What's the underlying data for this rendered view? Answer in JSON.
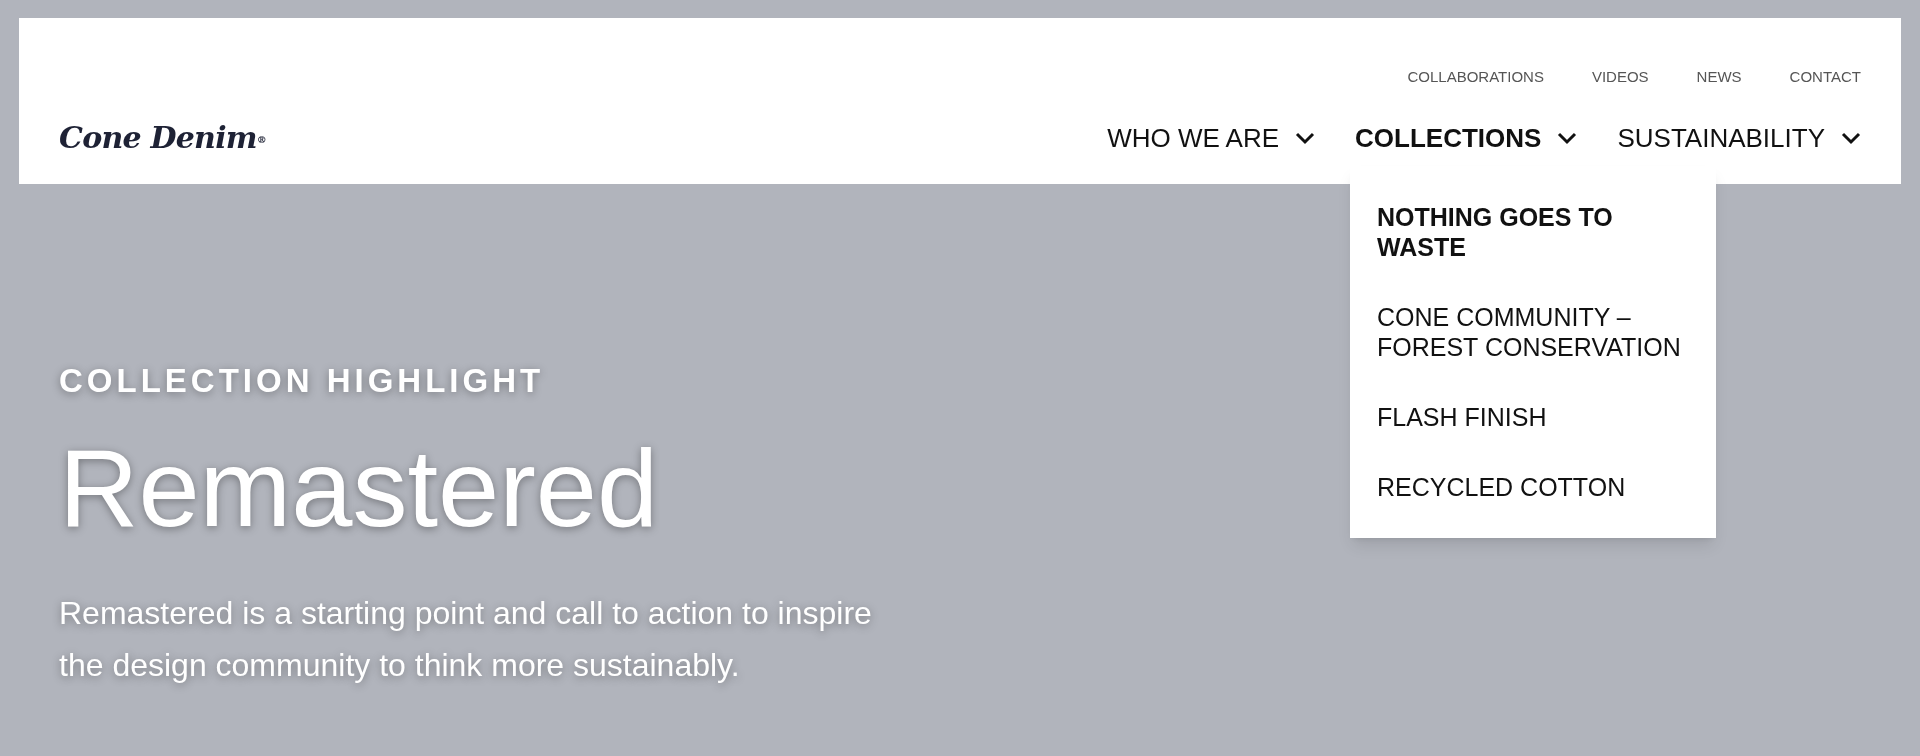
{
  "logo": {
    "text": "Cone Denim",
    "mark": "®"
  },
  "top_links": [
    "COLLABORATIONS",
    "VIDEOS",
    "NEWS",
    "CONTACT"
  ],
  "main_nav": [
    {
      "label": "WHO WE ARE",
      "selected": false
    },
    {
      "label": "COLLECTIONS",
      "selected": true
    },
    {
      "label": "SUSTAINABILITY",
      "selected": false
    }
  ],
  "dropdown": [
    {
      "label": "NOTHING GOES TO WASTE",
      "selected": true
    },
    {
      "label": "CONE COMMUNITY – FOREST CONSERVATION",
      "selected": false
    },
    {
      "label": "FLASH FINISH",
      "selected": false
    },
    {
      "label": "RECYCLED COTTON",
      "selected": false
    }
  ],
  "hero": {
    "eyebrow": "COLLECTION HIGHLIGHT",
    "title": "Remastered",
    "text": "Remastered is a starting point and call to action to inspire the design community to think more sustainably."
  }
}
